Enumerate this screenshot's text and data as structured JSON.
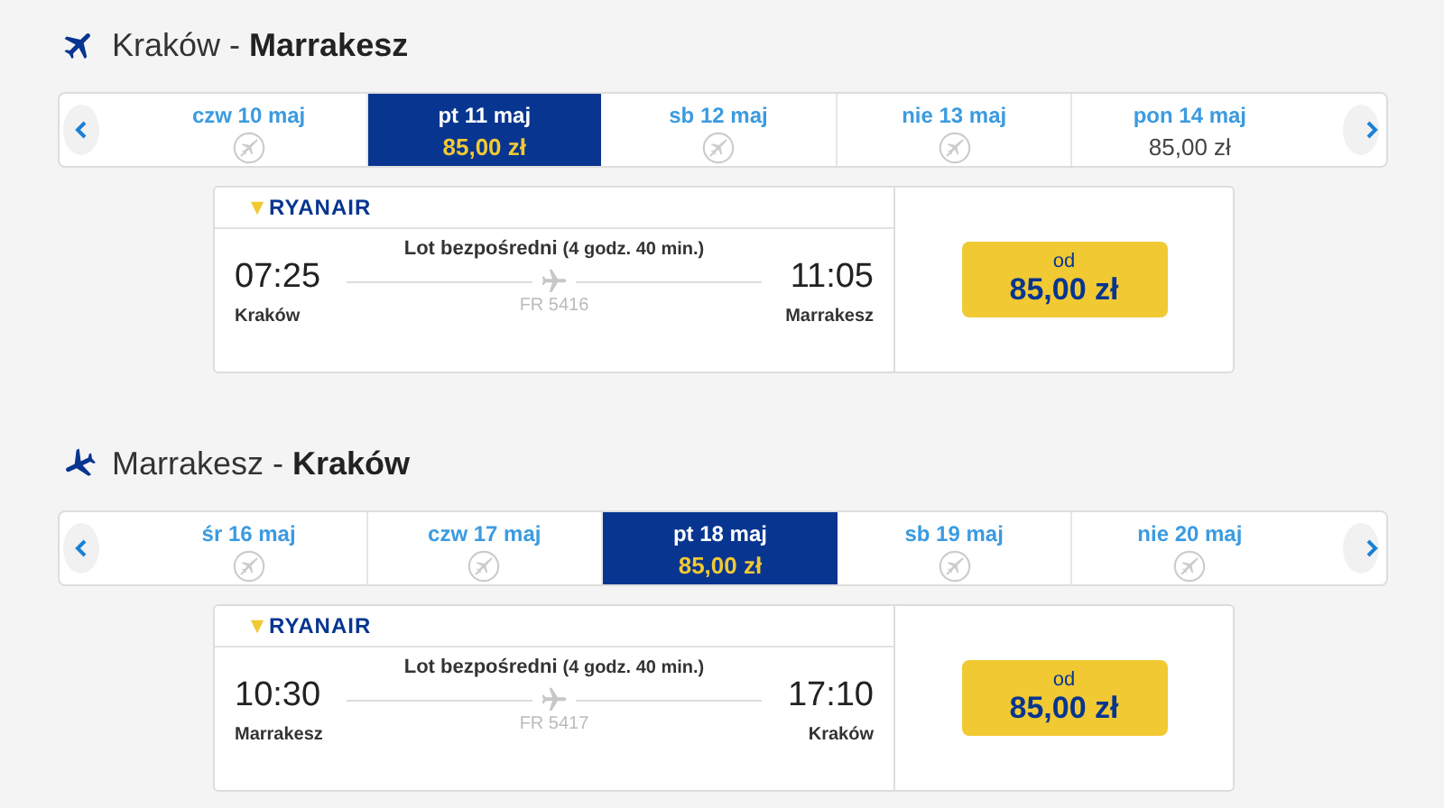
{
  "sections": [
    {
      "kind": "outbound",
      "title": "Kraków - **Marrakesz**",
      "days": [
        {
          "label": "czw 10 maj",
          "kind": "no-flight",
          "selected": false
        },
        {
          "label": "pt 11 maj",
          "kind": "fare",
          "price": "85,00 zł",
          "selected": true
        },
        {
          "label": "sb 12 maj",
          "kind": "no-flight",
          "selected": false
        },
        {
          "label": "nie 13 maj",
          "kind": "no-flight",
          "selected": false
        },
        {
          "label": "pon 14 maj",
          "kind": "fare",
          "price": "85,00 zł",
          "selected": false
        }
      ],
      "flight": {
        "airline": "RYANAIR",
        "type": "Lot bezpośredni",
        "duration": "(4 godz. 40 min.)",
        "depart_time": "07:25",
        "depart_city": "Kraków",
        "arrive_time": "11:05",
        "arrive_city": "Marrakesz",
        "number": "FR 5416",
        "price_label": "od",
        "price": "85,00 zł"
      }
    },
    {
      "kind": "inbound",
      "title": "Marrakesz - **Kraków**",
      "days": [
        {
          "label": "śr 16 maj",
          "kind": "no-flight",
          "selected": false
        },
        {
          "label": "czw 17 maj",
          "kind": "no-flight",
          "selected": false
        },
        {
          "label": "pt 18 maj",
          "kind": "fare",
          "price": "85,00 zł",
          "selected": true
        },
        {
          "label": "sb 19 maj",
          "kind": "no-flight",
          "selected": false
        },
        {
          "label": "nie 20 maj",
          "kind": "no-flight",
          "selected": false
        }
      ],
      "flight": {
        "airline": "RYANAIR",
        "type": "Lot bezpośredni",
        "duration": "(4 godz. 40 min.)",
        "depart_time": "10:30",
        "depart_city": "Marrakesz",
        "arrive_time": "17:10",
        "arrive_city": "Kraków",
        "number": "FR 5417",
        "price_label": "od",
        "price": "85,00 zł"
      }
    }
  ]
}
